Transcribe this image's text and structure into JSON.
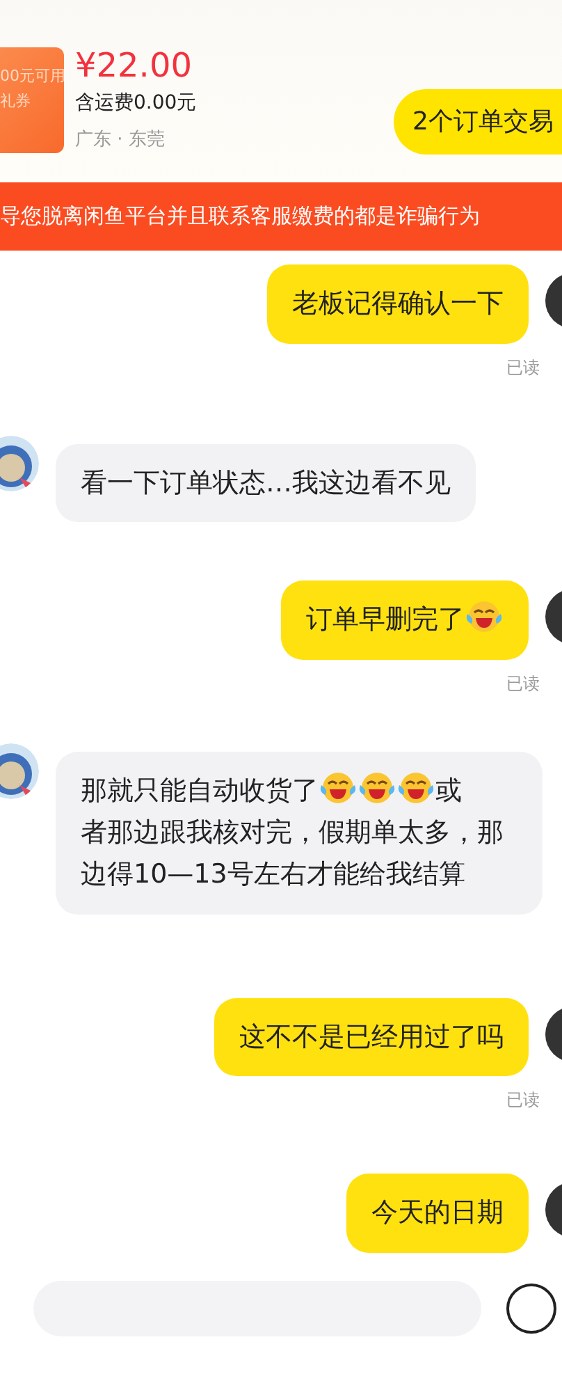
{
  "product": {
    "coupon_lines": [
      "00元可用",
      "礼券"
    ],
    "price": "¥22.00",
    "shipping": "含运费0.00元",
    "location": "广东 · 东莞",
    "order_button": "2个订单交易"
  },
  "warning_banner": "导您脱离闲鱼平台并且联系客服缴费的都是诈骗行为",
  "messages": [
    {
      "outgoing": true,
      "parts": [
        {
          "kind": "text",
          "text": "老板记得确认一下"
        }
      ],
      "receipt": "已读"
    },
    {
      "outgoing": false,
      "parts": [
        {
          "kind": "text",
          "text": "看一下订单状态…我这边看不见"
        }
      ]
    },
    {
      "outgoing": true,
      "parts": [
        {
          "kind": "text",
          "text": "订单早删完了"
        },
        {
          "kind": "emoji"
        }
      ],
      "receipt": "已读"
    },
    {
      "outgoing": false,
      "parts": [
        {
          "kind": "text",
          "text": "那就只能自动收货了"
        },
        {
          "kind": "emoji"
        },
        {
          "kind": "emoji"
        },
        {
          "kind": "emoji"
        },
        {
          "kind": "text",
          "text": "或"
        },
        {
          "kind": "paragraph",
          "text": "者那边跟我核对完，假期单太多，那边得10—13号左右才能给我结算"
        }
      ]
    },
    {
      "outgoing": true,
      "parts": [
        {
          "kind": "text",
          "text": "这不不是已经用过了吗"
        }
      ],
      "receipt": "已读"
    },
    {
      "outgoing": true,
      "parts": [
        {
          "kind": "text",
          "text": "今天的日期"
        }
      ]
    }
  ]
}
